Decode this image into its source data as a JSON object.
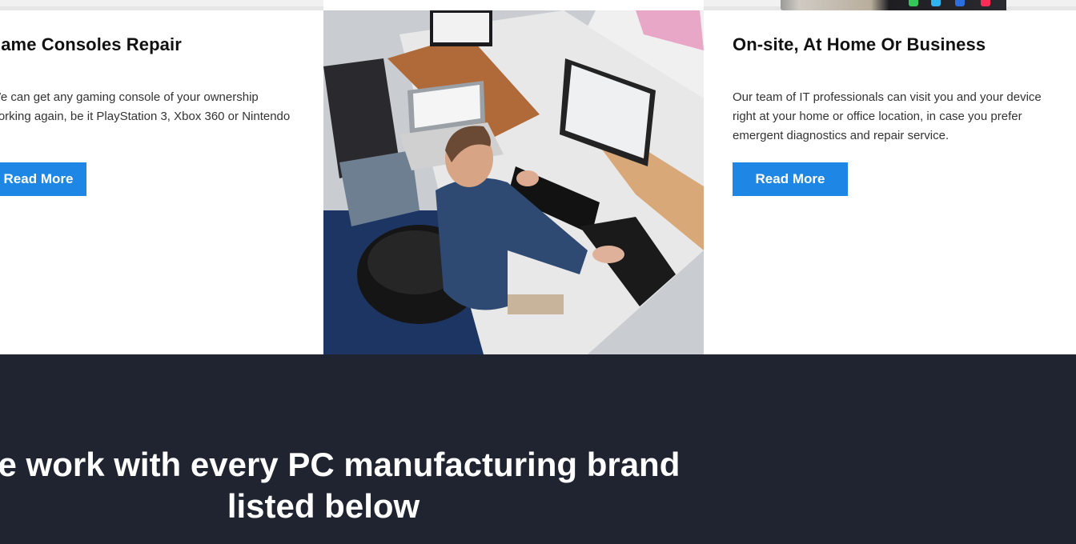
{
  "cards": {
    "left": {
      "title": "Game Consoles Repair",
      "text": "We can get any gaming console of your ownership\nworking again, be it PlayStation 3, Xbox 360 or Nintendo",
      "button": "Read More"
    },
    "right": {
      "title": "On-site, At Home Or Business",
      "text": "Our team of IT professionals can visit you and your device right at your home or office location, in case you prefer emergent diagnostics and repair service.",
      "button": "Read More"
    }
  },
  "band": {
    "heading": "We work with every PC manufacturing brand listed below"
  },
  "colors": {
    "button": "#1e87e6",
    "band": "#1f2430"
  }
}
